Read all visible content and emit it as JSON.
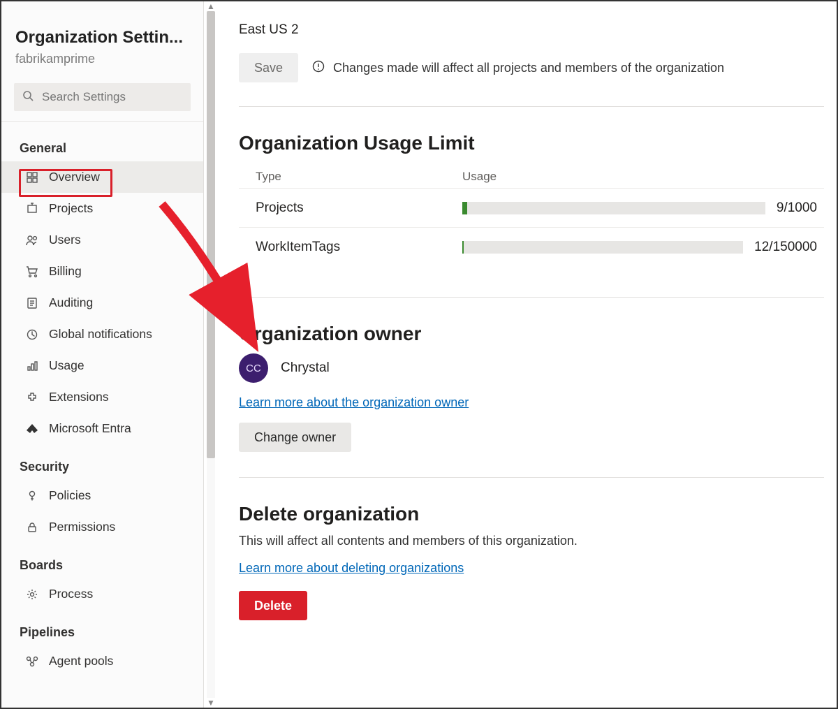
{
  "sidebar": {
    "title": "Organization Settin...",
    "subtitle": "fabrikamprime",
    "search_placeholder": "Search Settings",
    "groups": [
      {
        "label": "General",
        "items": [
          {
            "key": "overview",
            "label": "Overview",
            "icon": "dashboard-icon",
            "active": true
          },
          {
            "key": "projects",
            "label": "Projects",
            "icon": "projects-icon"
          },
          {
            "key": "users",
            "label": "Users",
            "icon": "users-icon"
          },
          {
            "key": "billing",
            "label": "Billing",
            "icon": "cart-icon"
          },
          {
            "key": "auditing",
            "label": "Auditing",
            "icon": "auditing-icon"
          },
          {
            "key": "globalnotifications",
            "label": "Global notifications",
            "icon": "notifications-icon"
          },
          {
            "key": "usage",
            "label": "Usage",
            "icon": "usage-icon"
          },
          {
            "key": "extensions",
            "label": "Extensions",
            "icon": "extensions-icon"
          },
          {
            "key": "microsoftentra",
            "label": "Microsoft Entra",
            "icon": "entra-icon"
          }
        ]
      },
      {
        "label": "Security",
        "items": [
          {
            "key": "policies",
            "label": "Policies",
            "icon": "policies-icon"
          },
          {
            "key": "permissions",
            "label": "Permissions",
            "icon": "permissions-icon"
          }
        ]
      },
      {
        "label": "Boards",
        "items": [
          {
            "key": "process",
            "label": "Process",
            "icon": "process-icon"
          }
        ]
      },
      {
        "label": "Pipelines",
        "items": [
          {
            "key": "agentpools",
            "label": "Agent pools",
            "icon": "agentpools-icon"
          }
        ]
      }
    ]
  },
  "main": {
    "region": "East US 2",
    "save_label": "Save",
    "save_note": "Changes made will affect all projects and members of the organization",
    "usage": {
      "heading": "Organization Usage Limit",
      "col_type": "Type",
      "col_usage": "Usage",
      "rows": [
        {
          "name": "Projects",
          "value": 9,
          "max": 1000,
          "display": "9/1000"
        },
        {
          "name": "WorkItemTags",
          "value": 12,
          "max": 150000,
          "display": "12/150000"
        }
      ]
    },
    "owner": {
      "heading": "Organization owner",
      "initials": "CC",
      "name": "Chrystal",
      "learn_more": "Learn more about the organization owner",
      "change_label": "Change owner"
    },
    "delete": {
      "heading": "Delete organization",
      "desc": "This will affect all contents and members of this organization.",
      "learn_more": "Learn more about deleting organizations",
      "button": "Delete"
    }
  }
}
